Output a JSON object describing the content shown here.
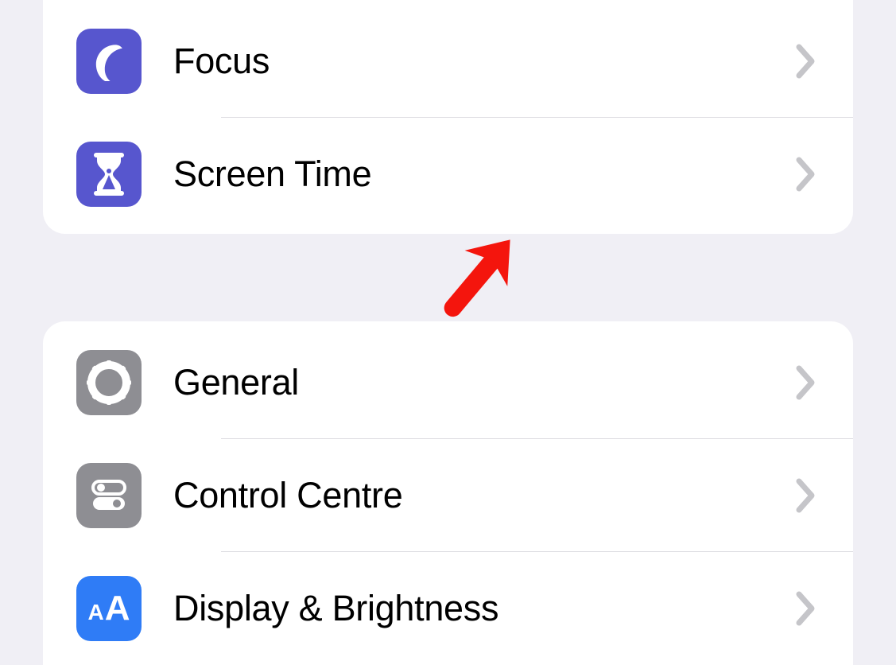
{
  "group1": {
    "items": [
      {
        "label": "Focus",
        "icon": "moon-icon",
        "iconColor": "purple"
      },
      {
        "label": "Screen Time",
        "icon": "hourglass-icon",
        "iconColor": "purple"
      }
    ]
  },
  "group2": {
    "items": [
      {
        "label": "General",
        "icon": "gear-icon",
        "iconColor": "gray"
      },
      {
        "label": "Control Centre",
        "icon": "toggles-icon",
        "iconColor": "gray"
      },
      {
        "label": "Display & Brightness",
        "icon": "textsize-icon",
        "iconColor": "blue"
      }
    ]
  },
  "annotation": {
    "type": "arrow",
    "targetLabel": "General"
  }
}
